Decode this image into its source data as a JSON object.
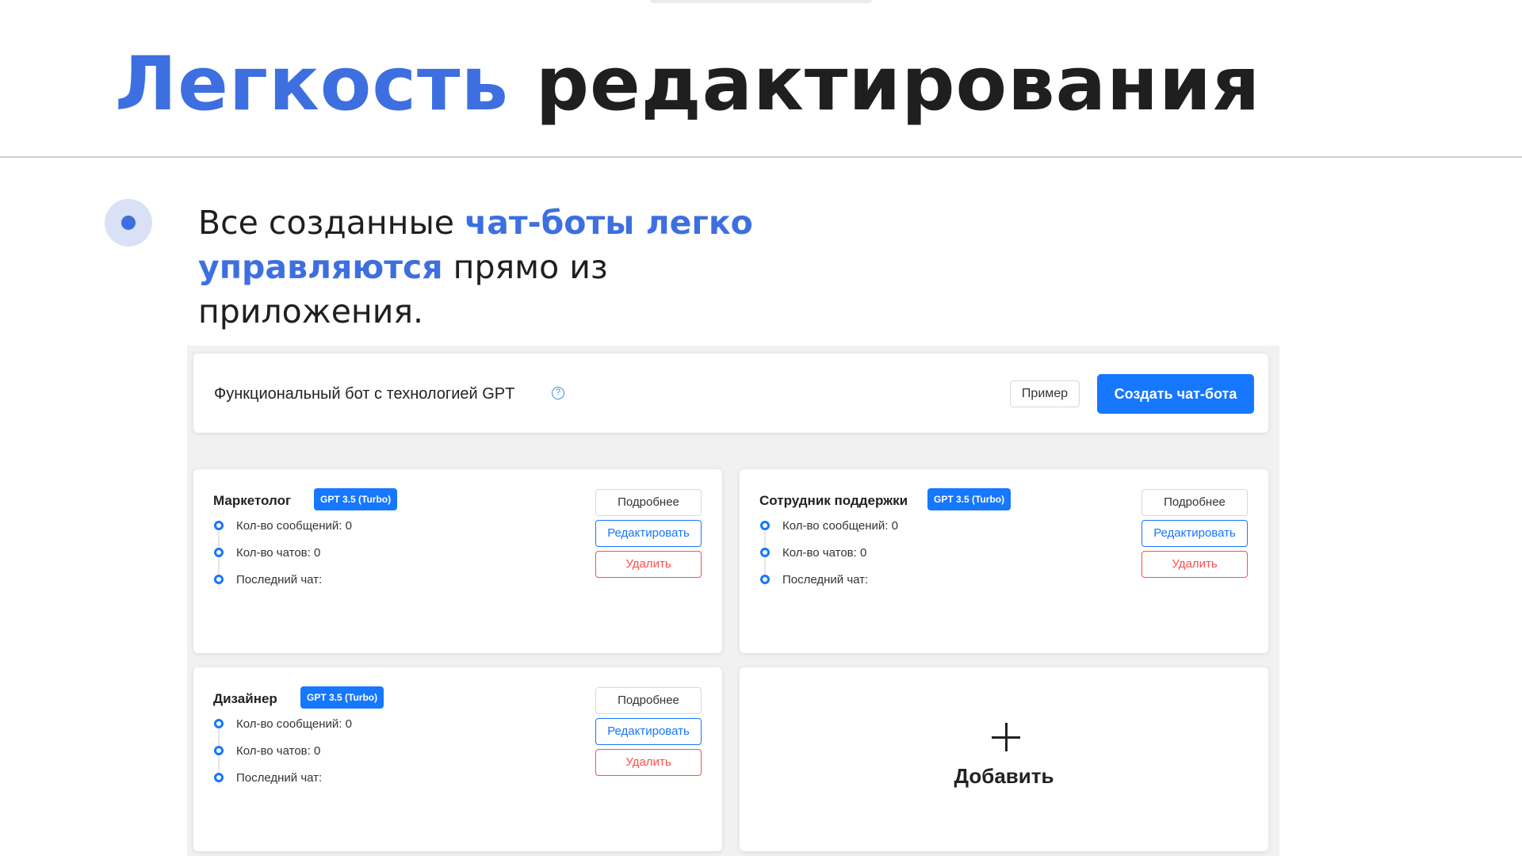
{
  "slide": {
    "title_accent": "Легкость",
    "title_rest": "редактирования",
    "lead_1": "Все созданные ",
    "lead_hl": "чат-боты легко управляются",
    "lead_2": " прямо из приложения."
  },
  "app": {
    "header": {
      "title": "Функциональный бот с технологией GPT",
      "help_icon": "?",
      "example_button": "Пример",
      "create_button": "Создать чат-бота"
    },
    "cards": [
      {
        "name": "Маркетолог",
        "model": "GPT 3.5 (Turbo)",
        "messages": "Кол-во сообщений: 0",
        "chats": "Кол-во чатов: 0",
        "last_chat": "Последний чат:",
        "more": "Подробнее",
        "edit": "Редактировать",
        "delete": "Удалить"
      },
      {
        "name": "Сотрудник поддержки",
        "model": "GPT 3.5 (Turbo)",
        "messages": "Кол-во сообщений: 0",
        "chats": "Кол-во чатов: 0",
        "last_chat": "Последний чат:",
        "more": "Подробнее",
        "edit": "Редактировать",
        "delete": "Удалить"
      },
      {
        "name": "Дизайнер",
        "model": "GPT 3.5 (Turbo)",
        "messages": "Кол-во сообщений: 0",
        "chats": "Кол-во чатов: 0",
        "last_chat": "Последний чат:",
        "more": "Подробнее",
        "edit": "Редактировать",
        "delete": "Удалить"
      }
    ],
    "add_card": {
      "label": "Добавить"
    }
  }
}
